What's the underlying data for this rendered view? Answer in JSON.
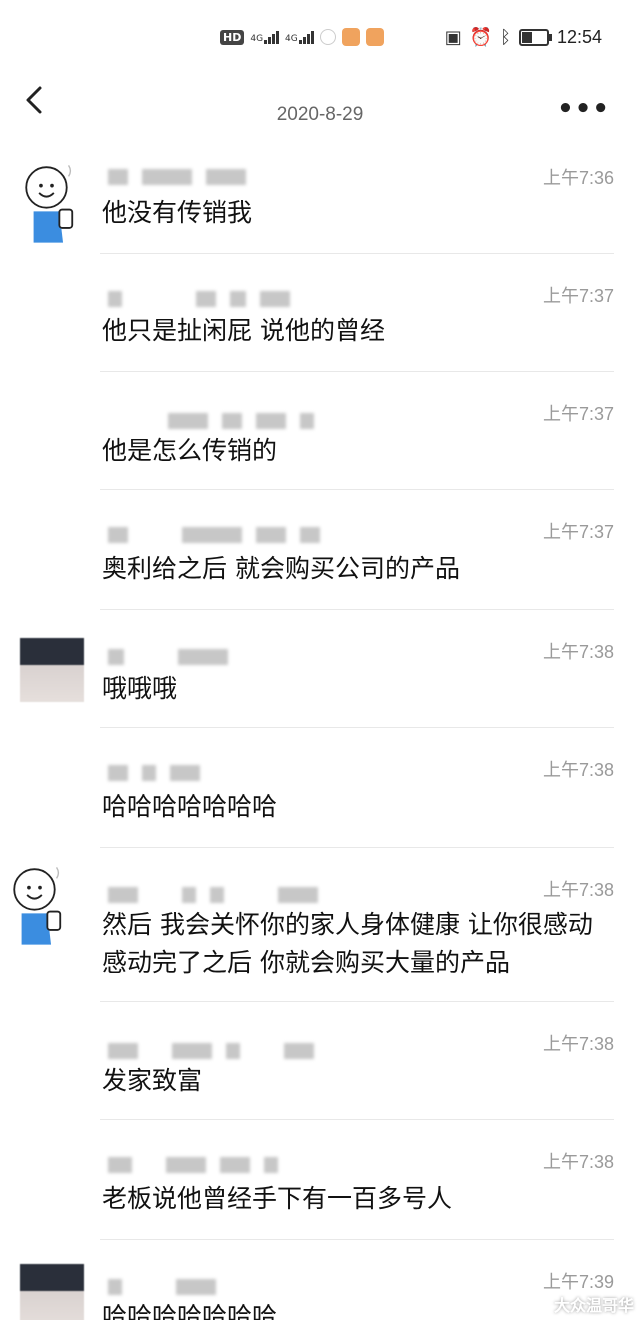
{
  "status_bar": {
    "hd_label": "HD",
    "net1": "4G",
    "net2": "4G",
    "time": "12:54"
  },
  "header": {
    "date": "2020-8-29"
  },
  "messages": [
    {
      "time": "上午7:36",
      "text": "他没有传销我"
    },
    {
      "time": "上午7:37",
      "text": "他只是扯闲屁 说他的曾经"
    },
    {
      "time": "上午7:37",
      "text": "他是怎么传销的"
    },
    {
      "time": "上午7:37",
      "text": "奥利给之后 就会购买公司的产品"
    },
    {
      "time": "上午7:38",
      "text": "哦哦哦"
    },
    {
      "time": "上午7:38",
      "text": "哈哈哈哈哈哈哈"
    },
    {
      "time": "上午7:38",
      "text": "然后 我会关怀你的家人身体健康 让你很感动 感动完了之后 你就会购买大量的产品"
    },
    {
      "time": "上午7:38",
      "text": "发家致富"
    },
    {
      "time": "上午7:38",
      "text": "老板说他曾经手下有一百多号人"
    },
    {
      "time": "上午7:39",
      "text": "哈哈哈哈哈哈哈"
    }
  ],
  "watermark": "大众温哥华"
}
